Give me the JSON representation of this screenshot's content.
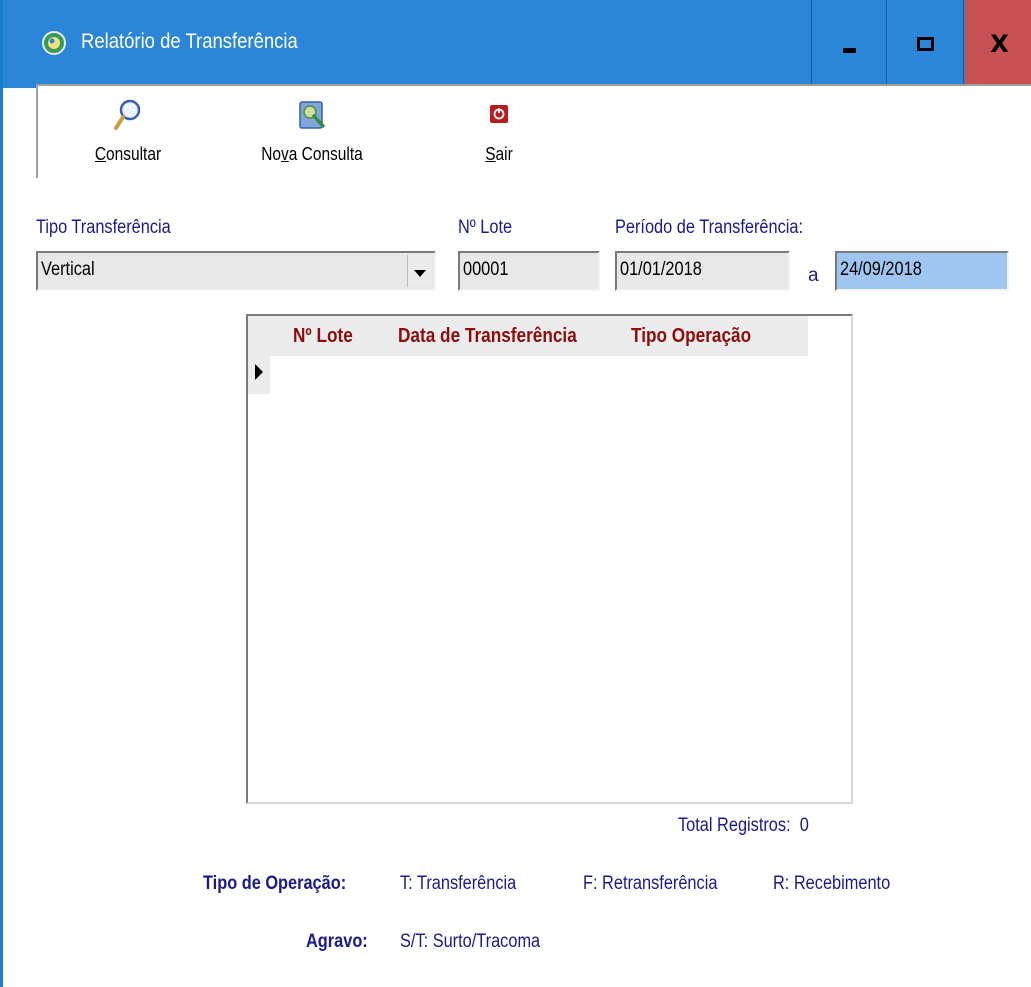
{
  "window": {
    "title": "Relatório de Transferência",
    "min_label": "minimize",
    "close_glyph": "X"
  },
  "toolbar": {
    "consultar": {
      "accel": "C",
      "rest": "onsultar",
      "icon": "magnifier-icon"
    },
    "nova_consulta": {
      "pre": "No",
      "accel": "v",
      "rest": "a Consulta",
      "icon": "new-query-icon"
    },
    "sair": {
      "accel": "S",
      "rest": "air",
      "icon": "power-icon"
    }
  },
  "form": {
    "tipo_label": "Tipo Transferência",
    "tipo_value": "Vertical",
    "lote_label": "Nº Lote",
    "lote_value": "00001",
    "periodo_label": "Período de Transferência:",
    "periodo_inicio": "01/01/2018",
    "periodo_sep": "a",
    "periodo_fim": "24/09/2018"
  },
  "grid": {
    "columns": [
      "Nº Lote",
      "Data de Transferência",
      "Tipo Operação"
    ],
    "rows": []
  },
  "footer": {
    "total_label": "Total Registros:",
    "total_value": "0",
    "tipo_operacao_label": "Tipo de Operação:",
    "tipo_t": "T: Transferência",
    "tipo_f": "F: Retransferência",
    "tipo_r": "R: Recebimento",
    "agravo_label": "Agravo:",
    "agravo_st": "S/T: Surto/Tracoma"
  },
  "colors": {
    "titlebar": "#2b86d8",
    "close_button": "#c75050",
    "label_text": "#1a1a8c",
    "grid_header_text": "#8b0d0d",
    "selected_field": "#9fc6f0"
  }
}
